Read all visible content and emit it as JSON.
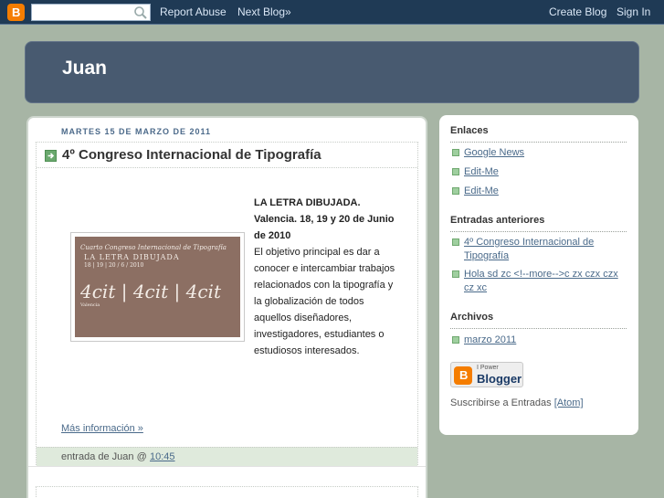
{
  "navbar": {
    "logo_letter": "B",
    "search_placeholder": "",
    "report_abuse": "Report Abuse",
    "next_blog": "Next Blog»",
    "create_blog": "Create Blog",
    "sign_in": "Sign In"
  },
  "header": {
    "title": "Juan"
  },
  "post": {
    "date": "MARTES 15 DE MARZO DE 2011",
    "title": "4º Congreso Internacional de Tipografía",
    "image_text": {
      "line1": "Cuarto Congreso Internacional de Tipografía",
      "line2": "LA LETRA DIBUJADA",
      "line3": "18 | 19 | 20 / 6 / 2010",
      "line4": "4cit | 4cit | 4cit",
      "line5": "Valencia"
    },
    "text_bold1": "LA LETRA DIBUJADA.",
    "text_bold2": "Valencia. 18, 19 y 20 de Junio de 2010",
    "text_body": "El objetivo principal es dar a conocer e intercambiar trabajos relacionados con la tipografía y la globalización de todos aquellos diseñadores, investigadores, estudiantes o estudiosos interesados.",
    "more_link": "Más información »",
    "footer_label": "entrada de Juan @",
    "time": "10:45"
  },
  "sidebar": {
    "links_heading": "Enlaces",
    "links": [
      {
        "label": "Google News"
      },
      {
        "label": "Edit-Me"
      },
      {
        "label": "Edit-Me"
      }
    ],
    "archive_heading": "Entradas anteriores",
    "previous_posts": [
      {
        "label": "4º Congreso Internacional de Tipografía"
      },
      {
        "label": "Hola sd zc <!--more-->c zx czx czx cz xc"
      }
    ],
    "archives_heading": "Archivos",
    "archives": [
      {
        "label": "marzo 2011"
      }
    ],
    "badge_power": "I Power",
    "badge_name": "Blogger",
    "subscribe_text": "Suscribirse a Entradas",
    "subscribe_link": "[Atom]"
  },
  "colors": {
    "background": "#a7b5a5",
    "navbar": "#1f3a55",
    "header": "#485a70",
    "link": "#4a6a8a",
    "blogger_orange": "#f57d00"
  },
  "icons": {
    "nav_search": "search-icon",
    "post_arrow": "arrow-right-icon",
    "list_bullet": "square-bullet-icon"
  }
}
